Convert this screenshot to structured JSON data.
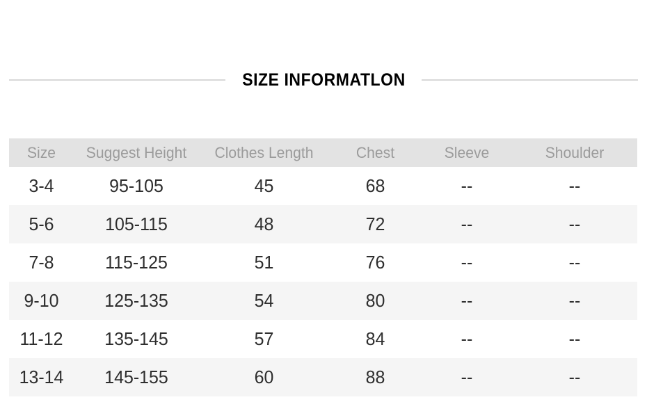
{
  "title": {
    "text": "SIZE INFORMATLON"
  },
  "colors": {
    "header_band": "#e3e3e3",
    "header_text": "#9b9b9b",
    "data_text": "#2e2e2e",
    "stripe": "#f5f5f5",
    "rule": "#d8d8d8",
    "title_text": "#000000"
  },
  "table": {
    "columns": [
      "Size",
      "Suggest Height",
      "Clothes Length",
      "Chest",
      "Sleeve",
      "Shoulder"
    ],
    "rows": [
      [
        "3-4",
        "95-105",
        "45",
        "68",
        "--",
        "--"
      ],
      [
        "5-6",
        "105-115",
        "48",
        "72",
        "--",
        "--"
      ],
      [
        "7-8",
        "115-125",
        "51",
        "76",
        "--",
        "--"
      ],
      [
        "9-10",
        "125-135",
        "54",
        "80",
        "--",
        "--"
      ],
      [
        "11-12",
        "135-145",
        "57",
        "84",
        "--",
        "--"
      ],
      [
        "13-14",
        "145-155",
        "60",
        "88",
        "--",
        "--"
      ]
    ]
  }
}
